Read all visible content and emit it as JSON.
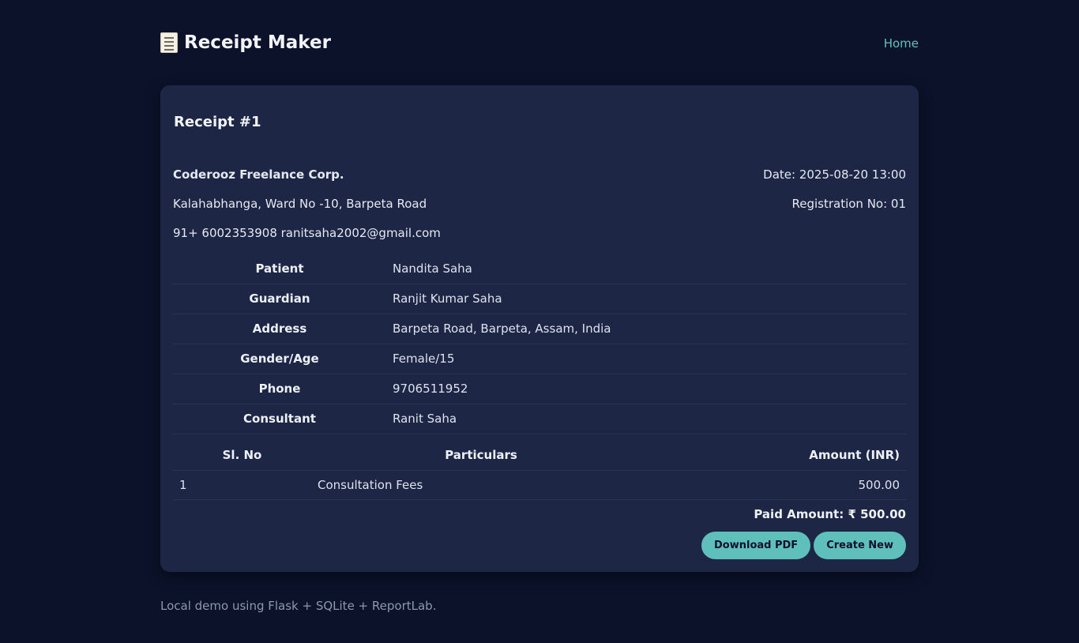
{
  "header": {
    "app_title": "Receipt Maker",
    "nav_home": "Home"
  },
  "receipt": {
    "title": "Receipt #1",
    "business": {
      "name": "Coderooz Freelance Corp.",
      "address": "Kalahabhanga, Ward No -10, Barpeta Road",
      "contact": "91+ 6002353908 ranitsaha2002@gmail.com"
    },
    "meta": {
      "date": "Date: 2025-08-20 13:00",
      "registration": "Registration No: 01"
    },
    "info": [
      {
        "label": "Patient",
        "value": "Nandita Saha"
      },
      {
        "label": "Guardian",
        "value": "Ranjit Kumar Saha"
      },
      {
        "label": "Address",
        "value": "Barpeta Road, Barpeta, Assam, India"
      },
      {
        "label": "Gender/Age",
        "value": "Female/15"
      },
      {
        "label": "Phone",
        "value": "9706511952"
      },
      {
        "label": "Consultant",
        "value": "Ranit Saha"
      }
    ],
    "items_headers": {
      "sl": "Sl. No",
      "particulars": "Particulars",
      "amount": "Amount (INR)"
    },
    "items": [
      {
        "sl": "1",
        "particulars": "Consultation Fees",
        "amount": "500.00"
      }
    ],
    "paid_amount": "Paid Amount: ₹ 500.00",
    "buttons": {
      "download": "Download PDF",
      "create": "Create New"
    }
  },
  "footer": {
    "text": "Local demo using Flask + SQLite + ReportLab."
  },
  "colors": {
    "background": "#0b1229",
    "card": "#1d2745",
    "accent": "#5fbfbb",
    "link": "#63c0bd"
  }
}
